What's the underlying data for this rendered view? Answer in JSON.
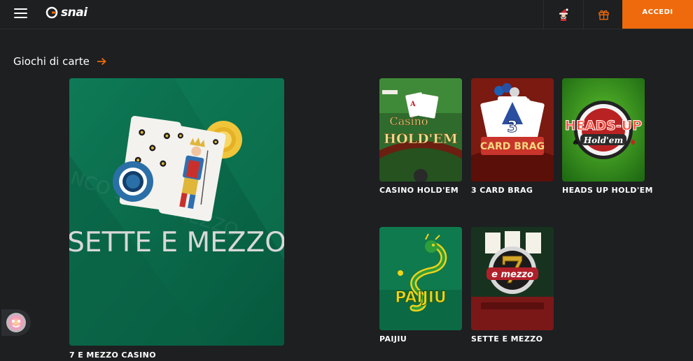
{
  "header": {
    "menu_icon": "hamburger-menu-icon",
    "logo_text": "snai",
    "santa_icon": "santa-icon",
    "gift_icon": "gift-icon",
    "login_label": "ACCEDI"
  },
  "section": {
    "title": "Giochi di carte",
    "arrow_icon": "arrow-right-icon"
  },
  "featured": {
    "art_text": "SETTE E MEZZO",
    "label": "7 E MEZZO CASINO"
  },
  "games": [
    {
      "label": "CASINO HOLD'EM",
      "art_text": "Casino Hold'em"
    },
    {
      "label": "3 CARD BRAG",
      "art_text": "CARD BRAG"
    },
    {
      "label": "HEADS UP HOLD'EM",
      "art_text": "HEADS-UP Hold'em"
    },
    {
      "label": "PAIJIU",
      "art_text": "PAIJIU"
    },
    {
      "label": "SETTE E MEZZO",
      "art_text": "e mezzo"
    }
  ],
  "colors": {
    "accent": "#ee6a0c",
    "background": "#1d1f21"
  }
}
